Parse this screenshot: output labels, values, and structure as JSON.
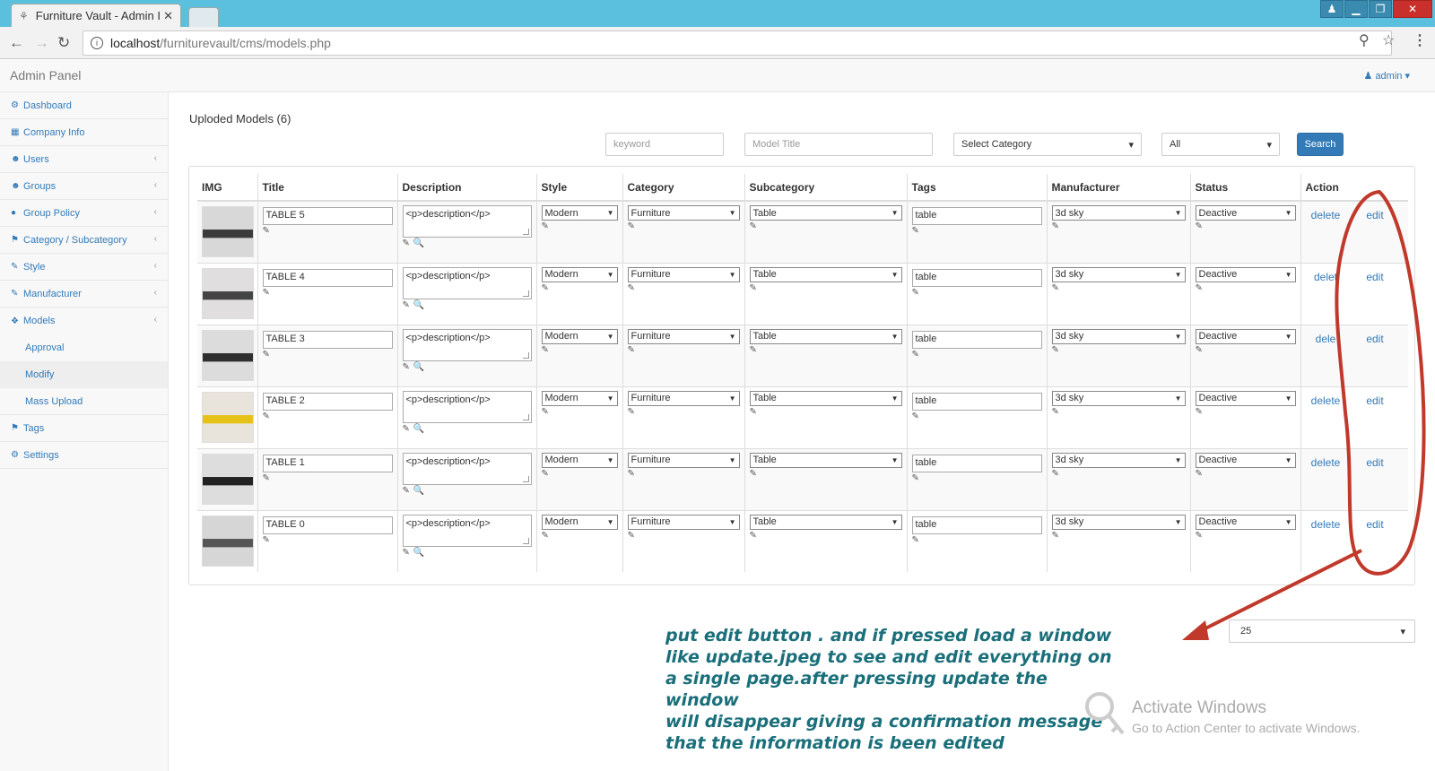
{
  "browser": {
    "tab_title": "Furniture Vault - Admin I",
    "url_host": "localhost",
    "url_path": "/furniturevault/cms/models.php"
  },
  "header": {
    "brand": "Admin Panel",
    "user": "admin"
  },
  "sidebar": {
    "items": [
      {
        "label": "Dashboard",
        "icon": "dashboard-icon"
      },
      {
        "label": "Company Info",
        "icon": "building-icon"
      },
      {
        "label": "Users",
        "icon": "users-icon"
      },
      {
        "label": "Groups",
        "icon": "groups-icon"
      },
      {
        "label": "Group Policy",
        "icon": "policy-icon"
      },
      {
        "label": "Category / Subcategory",
        "icon": "tag-icon"
      },
      {
        "label": "Style",
        "icon": "wrench-icon"
      },
      {
        "label": "Manufacturer",
        "icon": "wrench-icon"
      },
      {
        "label": "Models",
        "icon": "models-icon"
      }
    ],
    "subitems": [
      "Approval",
      "Modify",
      "Mass Upload"
    ],
    "footer_items": [
      {
        "label": "Tags",
        "icon": "tags-icon"
      },
      {
        "label": "Settings",
        "icon": "gears-icon"
      }
    ]
  },
  "main": {
    "title": "Uploded Models (6)",
    "filters": {
      "keyword_placeholder": "keyword",
      "title_placeholder": "Model Title",
      "category": "Select Category",
      "status": "All",
      "search_label": "Search"
    },
    "columns": [
      "IMG",
      "Title",
      "Description",
      "Style",
      "Category",
      "Subcategory",
      "Tags",
      "Manufacturer",
      "Status",
      "Action"
    ],
    "rows": [
      {
        "title": "TABLE 5",
        "description": "<p>description</p>",
        "style": "Modern",
        "category": "Furniture",
        "subcategory": "Table",
        "tags": "table",
        "manufacturer": "3d sky",
        "status": "Deactive",
        "delete": "delete",
        "edit": "edit"
      },
      {
        "title": "TABLE 4",
        "description": "<p>description</p>",
        "style": "Modern",
        "category": "Furniture",
        "subcategory": "Table",
        "tags": "table",
        "manufacturer": "3d sky",
        "status": "Deactive",
        "delete": "delet",
        "edit": "edit"
      },
      {
        "title": "TABLE 3",
        "description": "<p>description</p>",
        "style": "Modern",
        "category": "Furniture",
        "subcategory": "Table",
        "tags": "table",
        "manufacturer": "3d sky",
        "status": "Deactive",
        "delete": "dele",
        "edit": "edit"
      },
      {
        "title": "TABLE 2",
        "description": "<p>description</p>",
        "style": "Modern",
        "category": "Furniture",
        "subcategory": "Table",
        "tags": "table",
        "manufacturer": "3d sky",
        "status": "Deactive",
        "delete": "delete",
        "edit": "edit"
      },
      {
        "title": "TABLE 1",
        "description": "<p>description</p>",
        "style": "Modern",
        "category": "Furniture",
        "subcategory": "Table",
        "tags": "table",
        "manufacturer": "3d sky",
        "status": "Deactive",
        "delete": "delete",
        "edit": "edit"
      },
      {
        "title": "TABLE 0",
        "description": "<p>description</p>",
        "style": "Modern",
        "category": "Furniture",
        "subcategory": "Table",
        "tags": "table",
        "manufacturer": "3d sky",
        "status": "Deactive",
        "delete": "delete",
        "edit": "edit"
      }
    ],
    "per_page": "25"
  },
  "annotation": {
    "lines": [
      "put edit button . and if pressed load a window",
      "like update.jpeg to see and edit everything on",
      "a single page.after pressing update the window",
      "will disappear giving a confirmation message",
      "that the information is been edited"
    ],
    "color": "#1a6f7a",
    "mark_color": "#c0392b"
  },
  "watermark": {
    "line1": "Activate Windows",
    "line2": "Go to Action Center to activate Windows."
  }
}
